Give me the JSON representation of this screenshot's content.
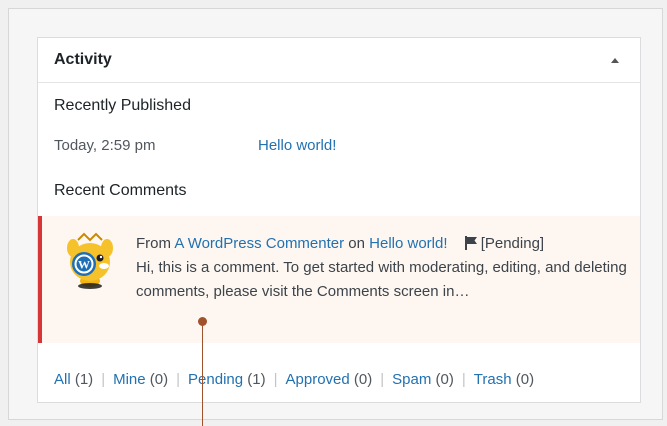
{
  "widget": {
    "title": "Activity"
  },
  "recently_published": {
    "heading": "Recently Published",
    "items": [
      {
        "date": "Today, 2:59 pm",
        "title": "Hello world!"
      }
    ]
  },
  "recent_comments": {
    "heading": "Recent Comments",
    "comment": {
      "from_prefix": "From",
      "author": "A WordPress Commenter",
      "on_word": "on",
      "post_title": "Hello world!",
      "status": "[Pending]",
      "excerpt": "Hi, this is a comment. To get started with moderating, editing, and deleting comments, please visit the Comments screen in…"
    }
  },
  "filters": [
    {
      "label": "All",
      "count": "(1)"
    },
    {
      "label": "Mine",
      "count": "(0)"
    },
    {
      "label": "Pending",
      "count": "(1)"
    },
    {
      "label": "Approved",
      "count": "(0)"
    },
    {
      "label": "Spam",
      "count": "(0)"
    },
    {
      "label": "Trash",
      "count": "(0)"
    }
  ],
  "colors": {
    "link": "#2271b1",
    "pending_border": "#d63638",
    "pending_bg": "#fef7f1",
    "annotation": "#a0522d"
  },
  "icons": {
    "toggle": "triangle-up-icon",
    "avatar": "wapuu-avatar-icon",
    "status": "flag-icon"
  }
}
